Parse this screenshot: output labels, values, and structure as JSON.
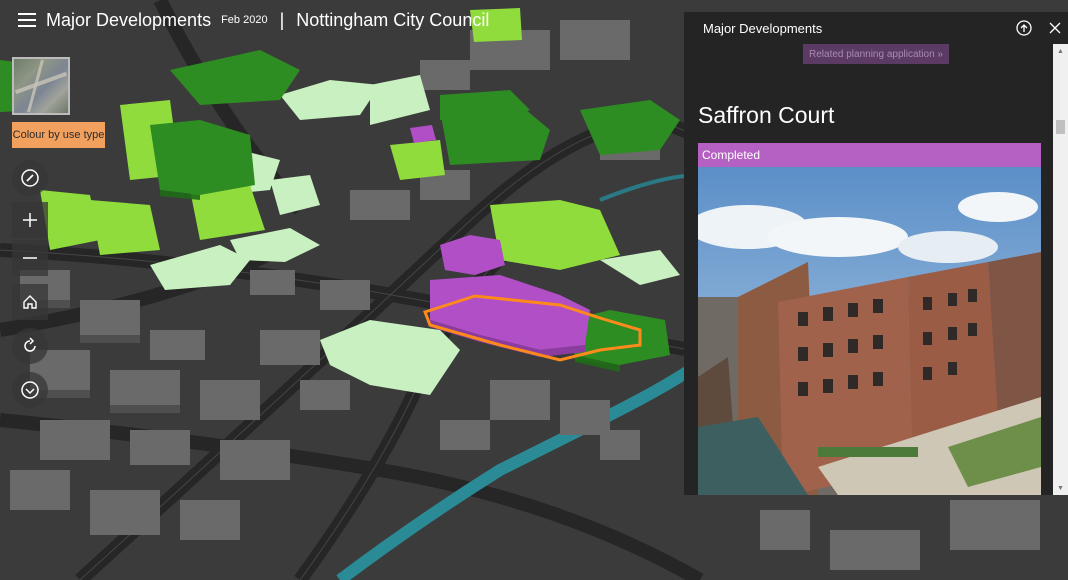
{
  "header": {
    "title": "Major Developments",
    "date": "Feb 2020",
    "separator": "|",
    "organisation": "Nottingham City Council"
  },
  "map": {
    "colour_button_label": "Colour by use type",
    "tools": [
      "compass-icon",
      "zoom-in-icon",
      "zoom-out-icon",
      "home-icon",
      "rotate-icon",
      "expand-down-icon"
    ],
    "use_colors": {
      "residential": "#c7f2c0",
      "mixed": "#8fdc3c",
      "office": "#2a8a1c",
      "completed": "#b14fc6",
      "selection": "#ff8a1c"
    }
  },
  "panel": {
    "title": "Major Developments",
    "related_link": "Related planning application »",
    "development_name": "Saffron Court",
    "status": "Completed",
    "status_color": "#b461c3",
    "photo_description": "Saffron Court development photo"
  }
}
